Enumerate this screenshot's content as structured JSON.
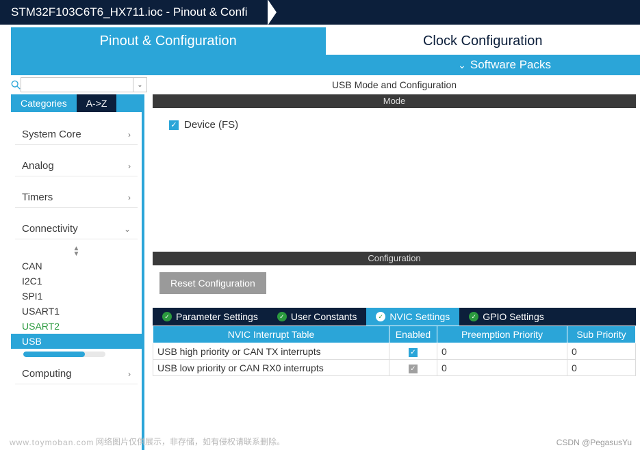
{
  "breadcrumb": {
    "title": "STM32F103C6T6_HX711.ioc - Pinout & Confi"
  },
  "main_tabs": {
    "pinout": "Pinout & Configuration",
    "clock": "Clock Configuration"
  },
  "software_packs": "Software Packs",
  "left": {
    "search_placeholder": "",
    "cat_tab1": "Categories",
    "cat_tab2": "A->Z",
    "groups": {
      "system": "System Core",
      "analog": "Analog",
      "timers": "Timers",
      "connectivity": "Connectivity",
      "computing": "Computing"
    },
    "connectivity_items": {
      "can": "CAN",
      "i2c1": "I2C1",
      "spi1": "SPI1",
      "usart1": "USART1",
      "usart2": "USART2",
      "usb": "USB"
    }
  },
  "right": {
    "panel_title": "USB Mode and Configuration",
    "mode_header": "Mode",
    "device_fs": "Device (FS)",
    "config_header": "Configuration",
    "reset_btn": "Reset Configuration",
    "tabs": {
      "param": "Parameter Settings",
      "user": "User Constants",
      "nvic": "NVIC Settings",
      "gpio": "GPIO Settings"
    },
    "table": {
      "h1": "NVIC Interrupt Table",
      "h2": "Enabled",
      "h3": "Preemption Priority",
      "h4": "Sub Priority",
      "rows": [
        {
          "name": "USB high priority or CAN TX interrupts",
          "enabled": true,
          "preempt": "0",
          "sub": "0"
        },
        {
          "name": "USB low priority or CAN RX0 interrupts",
          "enabled": true,
          "preempt": "0",
          "sub": "0"
        }
      ]
    }
  },
  "footer": {
    "watermark": "www.toymoban.com",
    "note": "网络图片仅供展示，非存储，如有侵权请联系删除。",
    "credit": "CSDN @PegasusYu"
  }
}
